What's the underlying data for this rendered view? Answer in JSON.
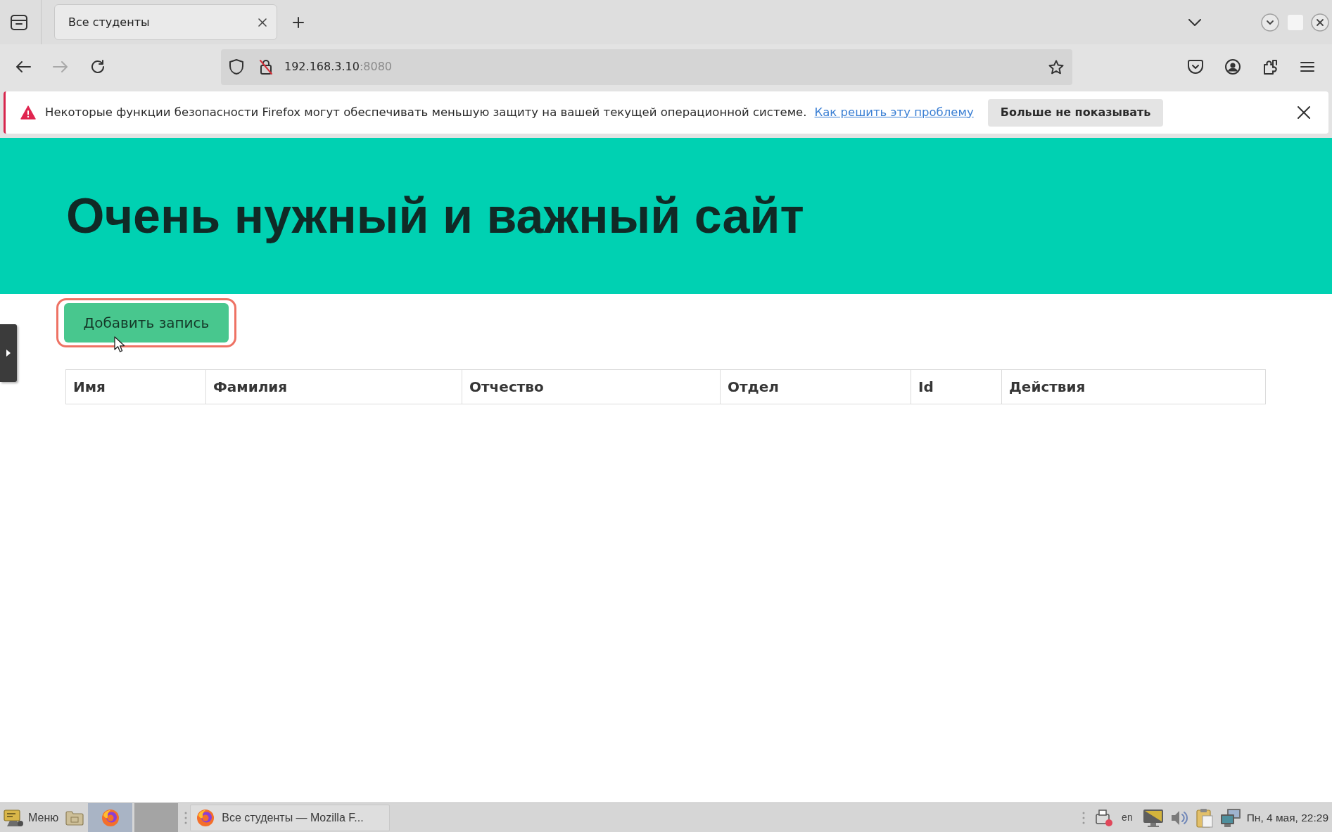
{
  "browser": {
    "tabs": [
      {
        "title": "Все студенты",
        "selected": true
      }
    ],
    "toolbar": {
      "forward_disabled": true
    },
    "address": {
      "host": "192.168.3.10",
      "port": ":8080"
    }
  },
  "notification": {
    "message": "Некоторые функции безопасности Firefox могут обеспечивать меньшую защиту на вашей текущей операционной системе.",
    "link": "Как решить эту проблему",
    "button": "Больше не показывать"
  },
  "page": {
    "heading": "Очень нужный и важный сайт",
    "add_button": {
      "label": "Добавить запись",
      "highlighted": true
    },
    "table": {
      "columns": [
        "Имя",
        "Фамилия",
        "Отчество",
        "Отдел",
        "Id",
        "Действия"
      ]
    }
  },
  "taskbar": {
    "menu_label": "Меню",
    "windows": [
      {
        "title": "Все студенты — Mozilla F..."
      }
    ],
    "language": "en",
    "clock": "Пн, 4 мая, 22:29"
  }
}
